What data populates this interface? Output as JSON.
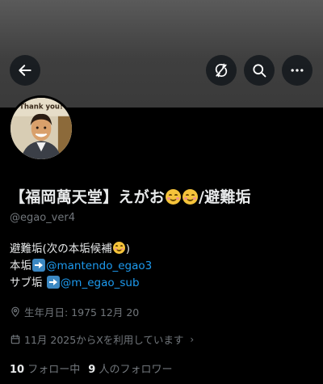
{
  "header": {
    "back_icon": "arrow-left-icon",
    "translate_icon": "translate-off-icon",
    "search_icon": "search-icon",
    "more_icon": "more-horizontal-icon"
  },
  "avatar": {
    "sign_text": "Thank you!"
  },
  "profile": {
    "name_prefix": "【福岡萬天堂】えがお",
    "name_suffix": "/避難垢",
    "handle": "@egao_ver4",
    "bio": {
      "line1": "避難垢(次の本垢候補",
      "line1_end": ")",
      "line2_label": "本垢",
      "line2_link": "@mantendo_egao3",
      "line3_label": "サブ垢 ",
      "line3_link": "@m_egao_sub"
    },
    "birthdate": "生年月日: 1975 12月 20",
    "joined": "11月 2025からXを利用しています",
    "following_count": "10",
    "following_label": "フォロー中",
    "followers_count": "9",
    "followers_label": "人のフォロワー"
  },
  "colors": {
    "background": "#000000",
    "link": "#1d9bf0",
    "secondary_text": "#71767b",
    "primary_text": "#e7e9ea"
  }
}
